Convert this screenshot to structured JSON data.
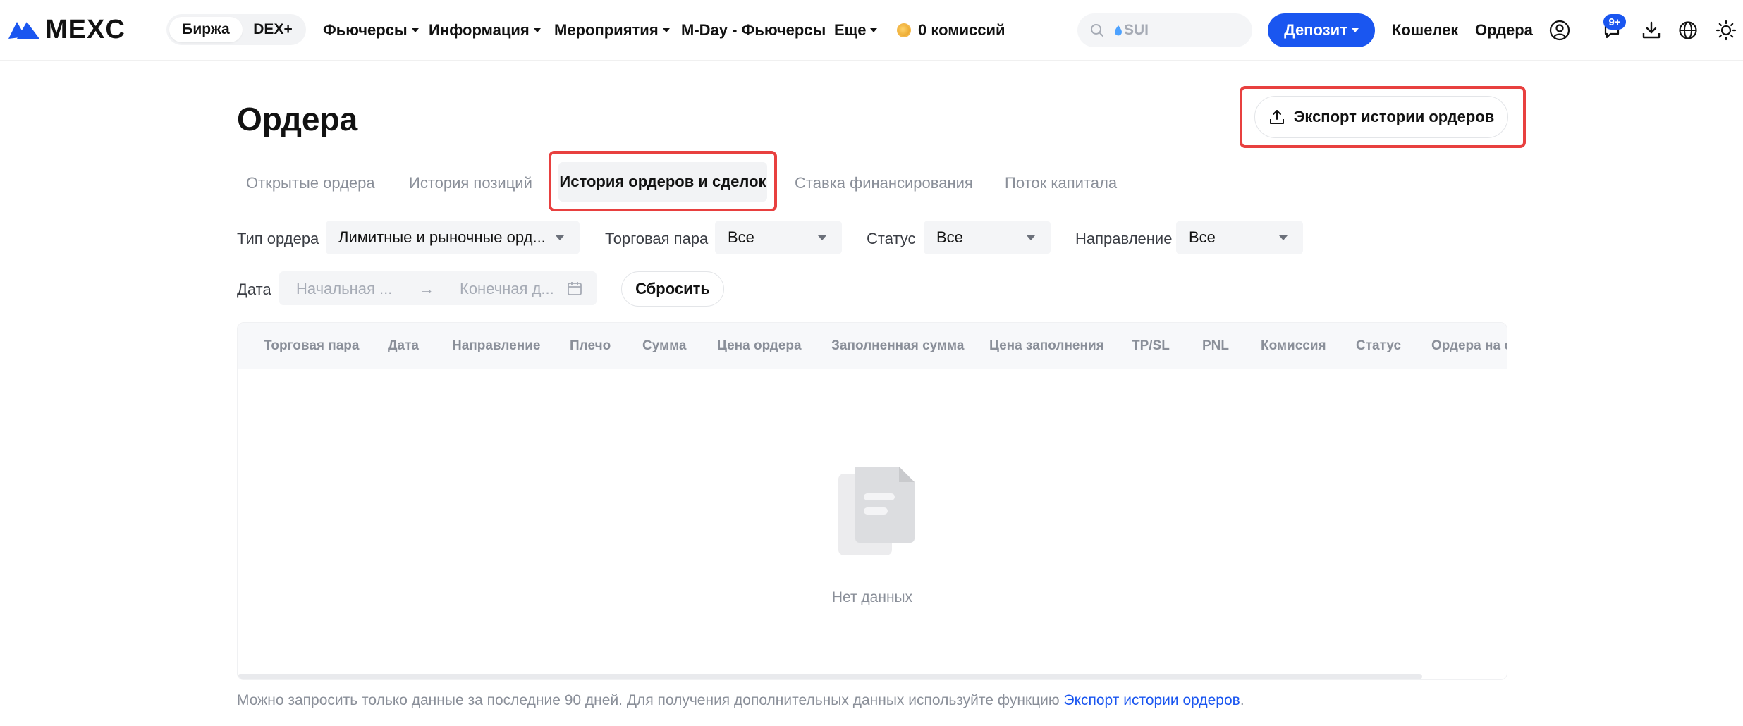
{
  "header": {
    "logo_text": "MEXC",
    "switch": {
      "exchange_label": "Биржа",
      "dex_label": "DEX+"
    },
    "nav": [
      {
        "label": "Фьючерсы",
        "has_caret": true
      },
      {
        "label": "Информация",
        "has_caret": true
      },
      {
        "label": "Мероприятия",
        "has_caret": true
      },
      {
        "label": "M-Day - Фьючерсы",
        "has_caret": false
      },
      {
        "label": "Еще",
        "has_caret": true
      },
      {
        "label": "0 комиссий",
        "has_caret": false
      }
    ],
    "search_placeholder": "SUI",
    "deposit_label": "Депозит",
    "wallet_label": "Кошелек",
    "orders_label": "Ордера",
    "notification_badge": "9+",
    "brand_color": "#1a56f0"
  },
  "page": {
    "title": "Ордера",
    "export_label": "Экспорт истории ордеров",
    "tabs": [
      {
        "label": "Открытые ордера"
      },
      {
        "label": "История позиций"
      },
      {
        "label": "История ордеров и сделок",
        "active": true
      },
      {
        "label": "Ставка финансирования"
      },
      {
        "label": "Поток капитала"
      }
    ],
    "filters": {
      "order_type_label": "Тип ордера",
      "order_type_value": "Лимитные и рыночные орд...",
      "pair_label": "Торговая пара",
      "pair_value": "Все",
      "status_label": "Статус",
      "status_value": "Все",
      "direction_label": "Направление",
      "direction_value": "Все",
      "date_label": "Дата",
      "date_start_placeholder": "Начальная ...",
      "date_end_placeholder": "Конечная д...",
      "reset_label": "Сбросить"
    },
    "table": {
      "columns": [
        "Торговая пара",
        "Дата",
        "Направление",
        "Плечо",
        "Сумма",
        "Цена ордера",
        "Заполненная сумма",
        "Цена заполнения",
        "TP/SL",
        "PNL",
        "Комиссия",
        "Статус",
        "Ордера на с"
      ],
      "empty_text": "Нет данных"
    },
    "footnote_text": "Можно запросить только данные за последние 90 дней. Для получения дополнительных данных используйте функцию ",
    "footnote_link": "Экспорт истории ордеров",
    "footnote_end": ".",
    "highlight_color": "#e8403f"
  }
}
